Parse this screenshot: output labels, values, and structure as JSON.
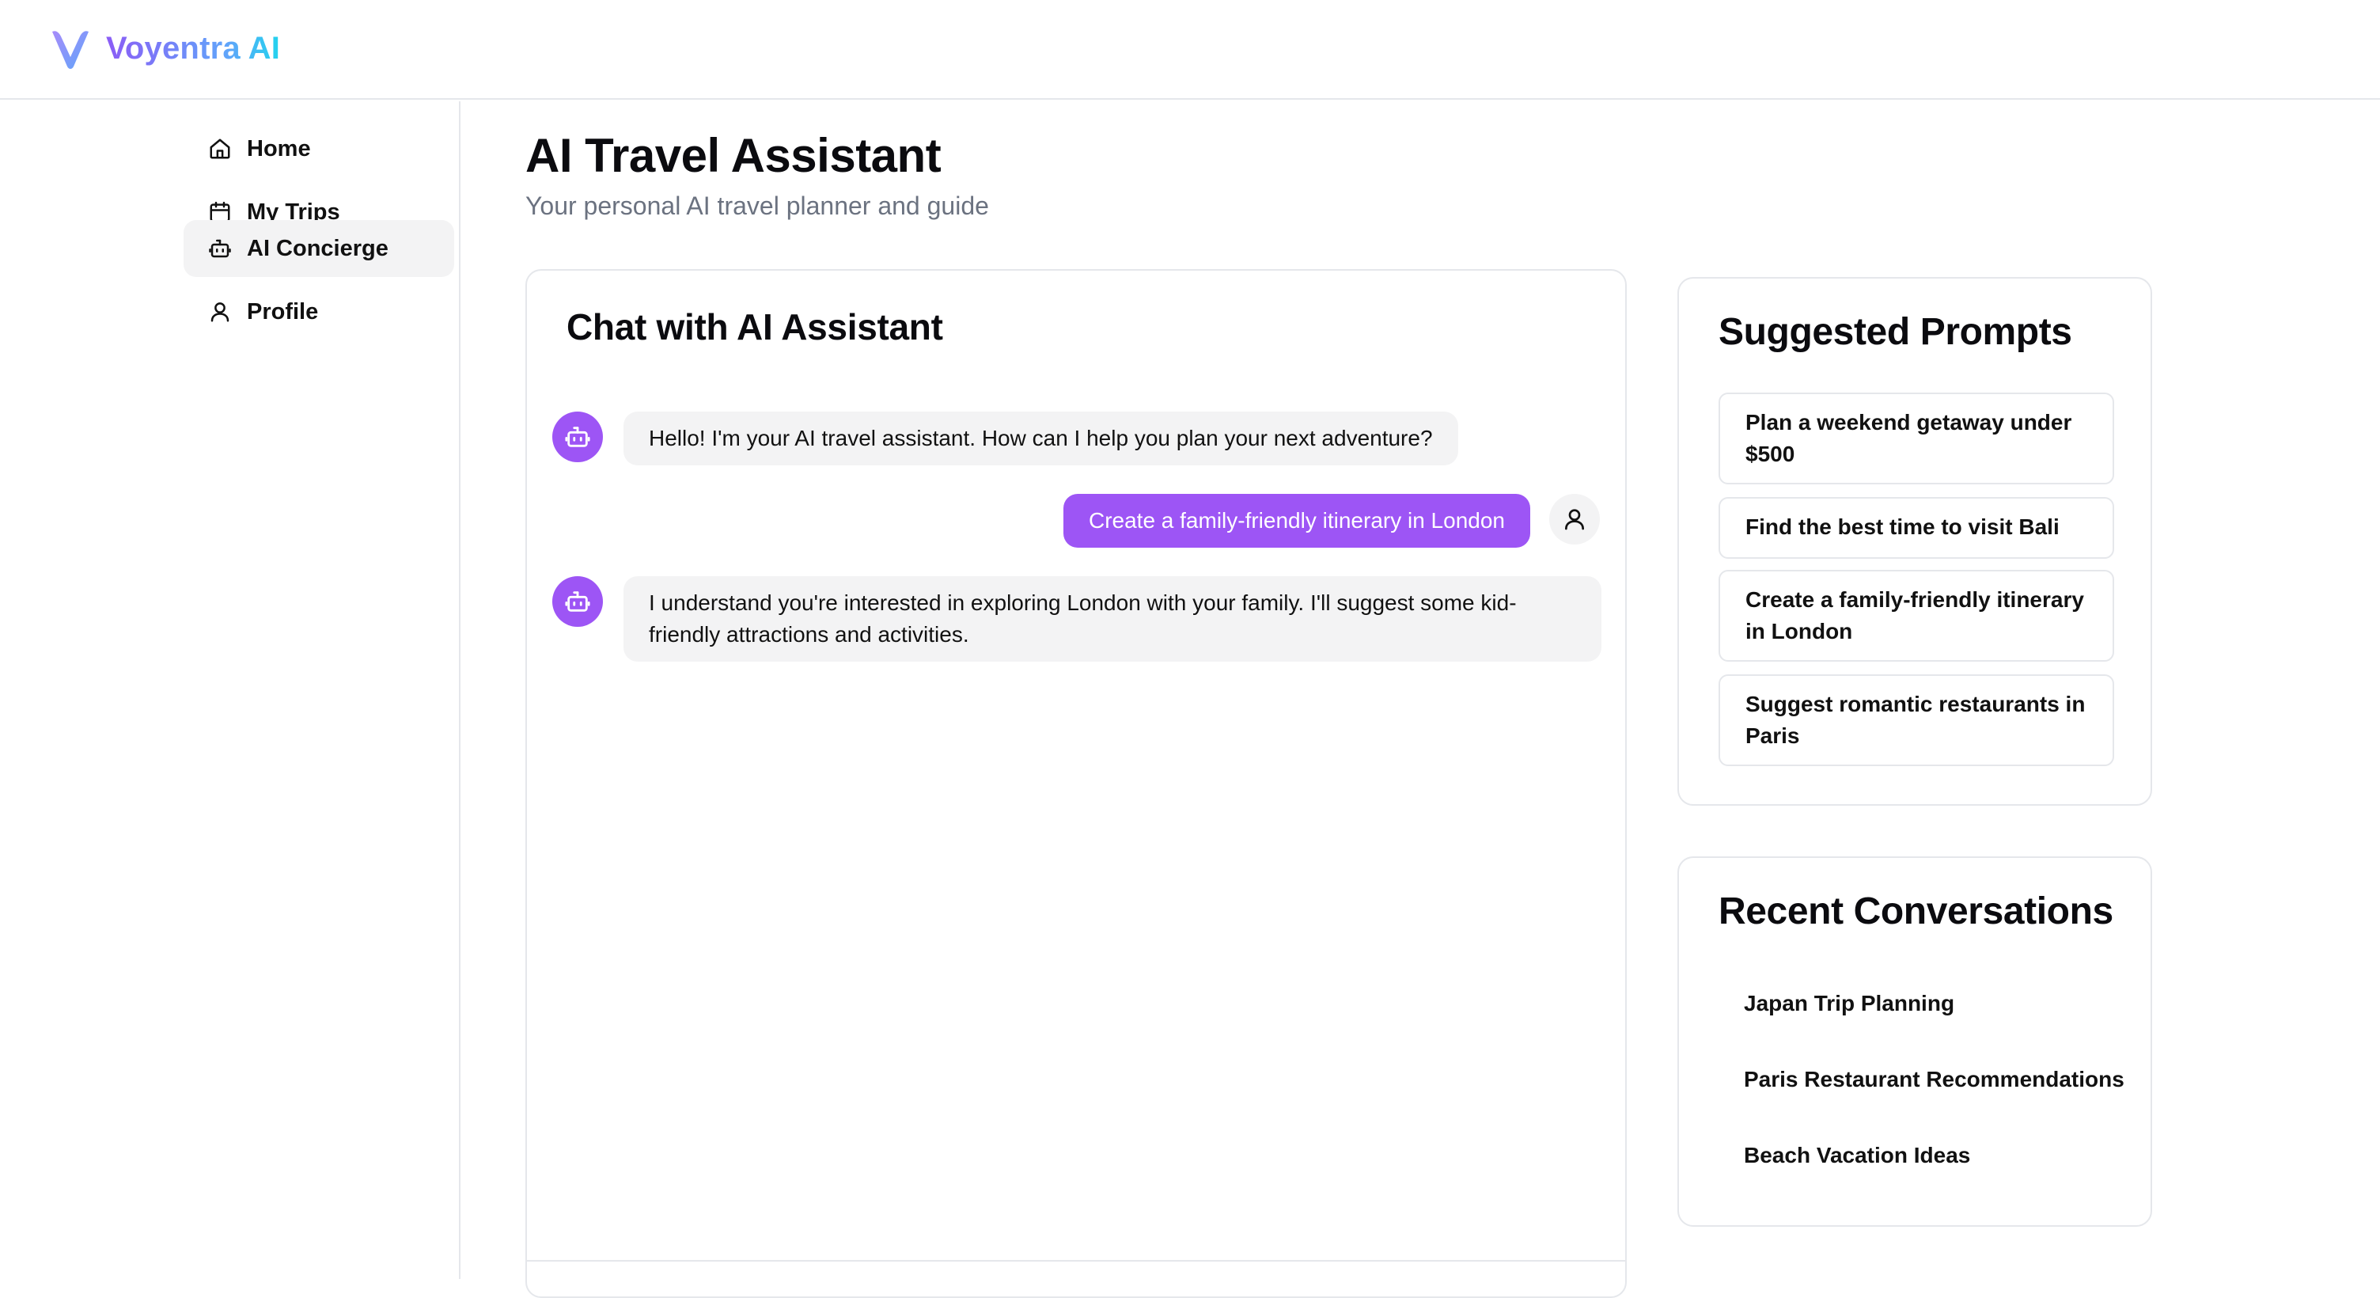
{
  "app": {
    "name": "Voyentra AI",
    "brand_gradient": [
      "#8b5cf6",
      "#60a5fa",
      "#22d3ee"
    ]
  },
  "sidebar": {
    "items": [
      {
        "label": "Home",
        "icon": "home-icon",
        "active": false
      },
      {
        "label": "My Trips",
        "icon": "calendar-icon",
        "active": false
      },
      {
        "label": "AI Concierge",
        "icon": "bot-icon",
        "active": true
      },
      {
        "label": "Profile",
        "icon": "user-icon",
        "active": false
      }
    ]
  },
  "header": {
    "title": "AI Travel Assistant",
    "subtitle": "Your personal AI travel planner and guide"
  },
  "chat": {
    "title": "Chat with AI Assistant",
    "messages": [
      {
        "role": "assistant",
        "text": "Hello! I'm your AI travel assistant. How can I help you plan your next adventure?"
      },
      {
        "role": "user",
        "text": "Create a family-friendly itinerary in London"
      },
      {
        "role": "assistant",
        "text": "I understand you're interested in exploring London with your family. I'll suggest some kid-friendly attractions and activities."
      }
    ]
  },
  "suggested_prompts": {
    "title": "Suggested Prompts",
    "items": [
      "Plan a weekend getaway under $500",
      "Find the best time to visit Bali",
      "Create a family-friendly itinerary in London",
      "Suggest romantic restaurants in Paris"
    ]
  },
  "recent_conversations": {
    "title": "Recent Conversations",
    "items": [
      "Japan Trip Planning",
      "Paris Restaurant Recommendations",
      "Beach Vacation Ideas"
    ]
  },
  "colors": {
    "accent": "#9d55f5",
    "muted_text": "#6b7280",
    "bubble_bg": "#f3f3f4",
    "border": "#e5e7eb"
  }
}
